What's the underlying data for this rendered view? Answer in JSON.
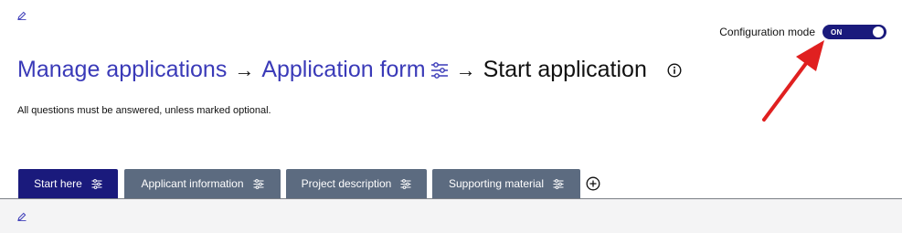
{
  "config": {
    "label": "Configuration mode",
    "toggle_state": "ON"
  },
  "breadcrumb": {
    "items": [
      {
        "label": "Manage applications"
      },
      {
        "label": "Application form"
      }
    ],
    "current": "Start application",
    "separator": "→"
  },
  "instructions": "All questions must be answered, unless marked optional.",
  "tabs": [
    {
      "label": "Start here",
      "active": true
    },
    {
      "label": "Applicant information",
      "active": false
    },
    {
      "label": "Project description",
      "active": false
    },
    {
      "label": "Supporting material",
      "active": false
    }
  ],
  "icons": {
    "edit": "pencil-icon",
    "settings": "sliders-icon",
    "info": "info-circle-icon",
    "add": "plus-circle-icon"
  },
  "colors": {
    "link": "#3a3ab8",
    "primary": "#1a1a7c",
    "tab_inactive": "#5c6b80",
    "annotation": "#e02020"
  }
}
